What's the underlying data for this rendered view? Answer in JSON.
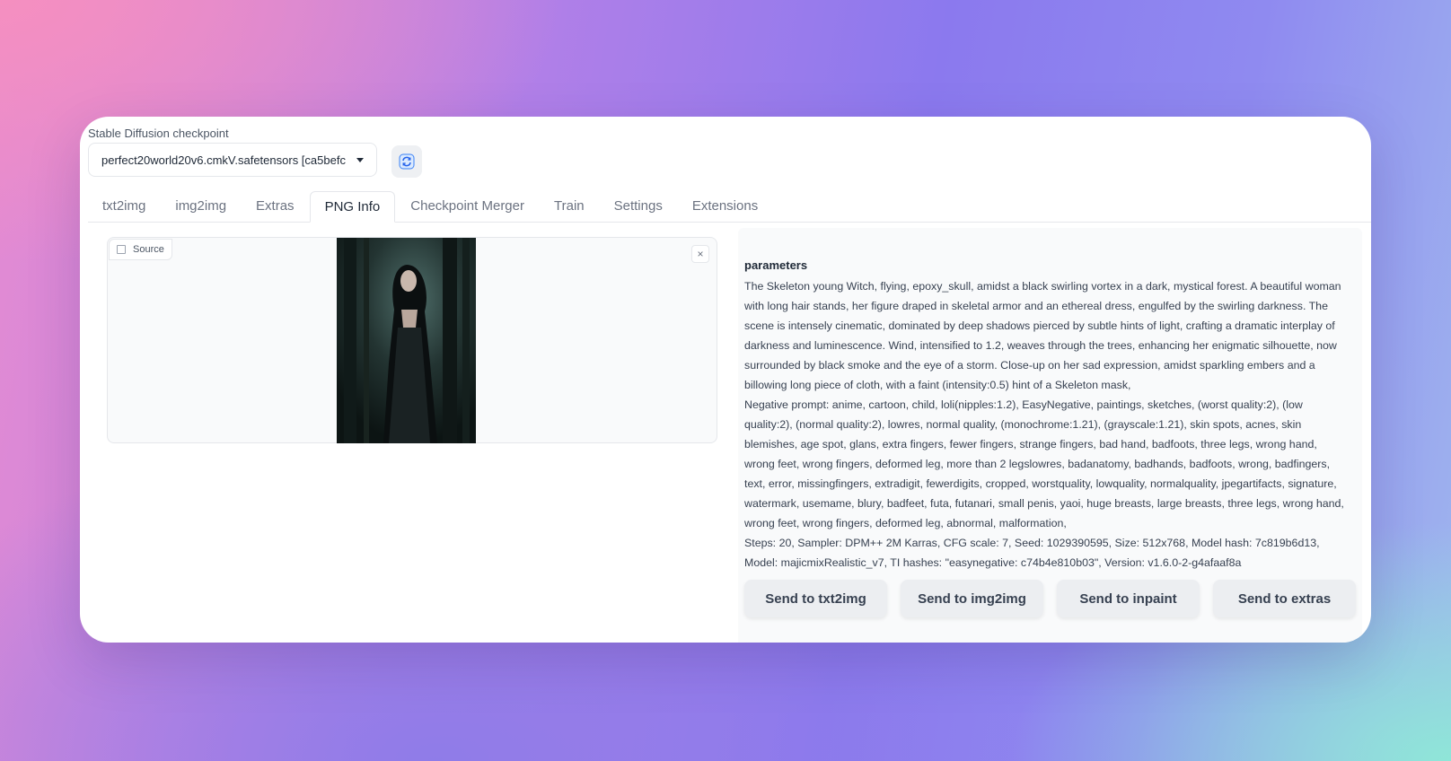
{
  "checkpoint": {
    "label": "Stable Diffusion checkpoint",
    "value": "perfect20world20v6.cmkV.safetensors [ca5befc"
  },
  "tabs": [
    {
      "label": "txt2img"
    },
    {
      "label": "img2img"
    },
    {
      "label": "Extras"
    },
    {
      "label": "PNG Info",
      "active": true
    },
    {
      "label": "Checkpoint Merger"
    },
    {
      "label": "Train"
    },
    {
      "label": "Settings"
    },
    {
      "label": "Extensions"
    }
  ],
  "source": {
    "label": "Source",
    "close_symbol": "×"
  },
  "params": {
    "title": "parameters",
    "prompt": "The Skeleton young Witch, flying, epoxy_skull, amidst a black swirling vortex in a dark, mystical forest. A beautiful woman with long hair stands, her figure draped in skeletal armor and an ethereal dress, engulfed by the swirling darkness. The scene is intensely cinematic, dominated by deep shadows pierced by subtle hints of light, crafting a dramatic interplay of darkness and luminescence. Wind, intensified to 1.2, weaves through the trees, enhancing her enigmatic silhouette, now surrounded by black smoke and the eye of a storm. Close-up on her sad expression, amidst sparkling embers and a billowing long piece of cloth, with a faint (intensity:0.5) hint of a Skeleton mask,",
    "negative": "Negative prompt: anime, cartoon, child, loli(nipples:1.2), EasyNegative, paintings, sketches, (worst quality:2), (low quality:2), (normal quality:2), lowres, normal quality, (monochrome:1.21), (grayscale:1.21), skin spots, acnes, skin blemishes, age spot, glans, extra fingers, fewer fingers, strange fingers, bad hand, badfoots, three legs, wrong hand, wrong feet, wrong fingers, deformed leg, more than 2 legslowres, badanatomy, badhands, badfoots, wrong, badfingers, text, error, missingfingers, extradigit, fewerdigits, cropped, worstquality, lowquality, normalquality, jpegartifacts, signature, watermark, usemame, blury, badfeet, futa, futanari, small penis, yaoi, huge breasts, large breasts, three legs, wrong hand, wrong feet, wrong fingers, deformed leg, abnormal, malformation,",
    "steps": "Steps: 20, Sampler: DPM++ 2M Karras, CFG scale: 7, Seed: 1029390595, Size: 512x768, Model hash: 7c819b6d13, Model: majicmixRealistic_v7, TI hashes: \"easynegative: c74b4e810b03\", Version: v1.6.0-2-g4afaaf8a"
  },
  "buttons": {
    "txt2img": "Send to txt2img",
    "img2img": "Send to img2img",
    "inpaint": "Send to inpaint",
    "extras": "Send to extras"
  },
  "colors": {
    "card_bg": "#ffffff",
    "panel_bg": "#f9fafb",
    "button_bg": "#eceef1",
    "refresh_icon": "#3b82f6"
  }
}
